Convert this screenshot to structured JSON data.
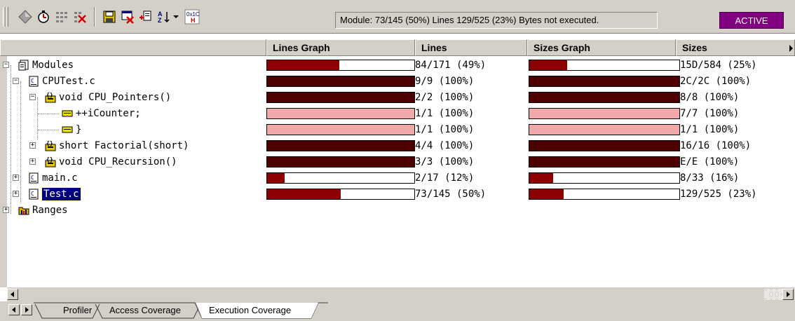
{
  "status": {
    "text": "Module: 73/145 (50%) Lines 129/525 (23%) Bytes not executed.",
    "badge": "ACTIVE",
    "badge_color": "#800080"
  },
  "toolbar": {
    "icons": [
      "diamond-icon",
      "timer-icon",
      "grid-icon",
      "clear-grid-icon",
      "save-icon",
      "delete-icon",
      "copy-icon",
      "sort-icon",
      "dropdown-arrow-icon",
      "hex-icon"
    ]
  },
  "columns": [
    "Lines Graph",
    "Lines",
    "Sizes Graph",
    "Sizes"
  ],
  "colors": {
    "bar_dark": "#8b0000",
    "bar_darker": "#4d0000",
    "bar_pink": "#f0a8a8",
    "selection": "#000080"
  },
  "rows": [
    {
      "label": "Modules",
      "icon": "modules-icon",
      "expander": "−",
      "lines_fill": 0.49,
      "lines": "84/171 (49%)",
      "sizes_fill": 0.25,
      "sizes": "15D/584 (25%)"
    },
    {
      "label": "CPUTest.c",
      "icon": "c-file-icon",
      "expander": "−",
      "lines_fill": 1.0,
      "lines": "9/9 (100%)",
      "sizes_fill": 1.0,
      "sizes": "2C/2C (100%)"
    },
    {
      "label": "void CPU_Pointers()",
      "icon": "function-icon",
      "expander": "−",
      "lines_fill": 1.0,
      "lines": "2/2 (100%)",
      "sizes_fill": 1.0,
      "sizes": "8/8 (100%)"
    },
    {
      "label": "++iCounter;",
      "icon": "line-icon",
      "expander": "",
      "lines_fill": 1.0,
      "lines": "1/1 (100%)",
      "sizes_fill": 1.0,
      "sizes": "7/7 (100%)"
    },
    {
      "label": "}",
      "icon": "line-icon",
      "expander": "",
      "lines_fill": 1.0,
      "lines": "1/1 (100%)",
      "sizes_fill": 1.0,
      "sizes": "1/1 (100%)"
    },
    {
      "label": "short Factorial(short)",
      "icon": "function-icon",
      "expander": "+",
      "lines_fill": 1.0,
      "lines": "4/4 (100%)",
      "sizes_fill": 1.0,
      "sizes": "16/16 (100%)"
    },
    {
      "label": "void CPU_Recursion()",
      "icon": "function-icon",
      "expander": "+",
      "lines_fill": 1.0,
      "lines": "3/3 (100%)",
      "sizes_fill": 1.0,
      "sizes": "E/E (100%)"
    },
    {
      "label": "main.c",
      "icon": "c-file-icon",
      "expander": "+",
      "lines_fill": 0.12,
      "lines": "2/17 (12%)",
      "sizes_fill": 0.16,
      "sizes": "8/33 (16%)"
    },
    {
      "label": "Test.c",
      "icon": "c-file-icon",
      "expander": "+",
      "lines_fill": 0.5,
      "lines": "73/145 (50%)",
      "sizes_fill": 0.23,
      "sizes": "129/525 (23%)",
      "selected": true
    },
    {
      "label": "Ranges",
      "icon": "ranges-icon",
      "expander": "+"
    }
  ],
  "tabs": [
    "Profiler",
    "Access Coverage",
    "Execution Coverage"
  ],
  "active_tab": "Execution Coverage"
}
